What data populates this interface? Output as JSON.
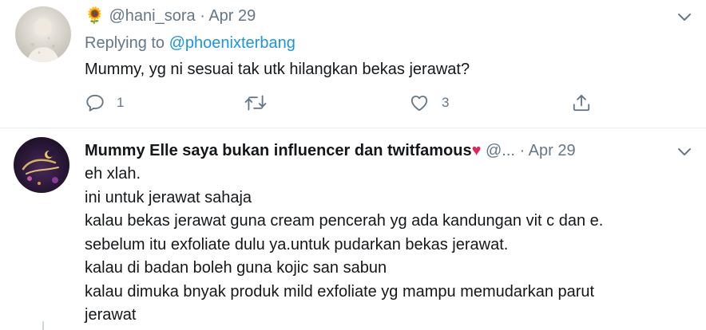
{
  "tweets": [
    {
      "emoji": "🌻",
      "handle": "@hani_sora",
      "sep": "·",
      "date": "Apr 29",
      "replying_label": "Replying to",
      "replying_to": "@phoenixterbang",
      "text": "Mummy, yg ni sesuai tak utk hilangkan bekas jerawat?",
      "reply_count": "1",
      "retweet_count": "",
      "like_count": "3"
    },
    {
      "display_name": "Mummy Elle saya bukan influencer dan twitfamous",
      "heart": "♥",
      "handle": "@...",
      "sep": "·",
      "date": "Apr 29",
      "lines": [
        "eh xlah.",
        "ini untuk jerawat sahaja",
        "kalau bekas jerawat guna cream pencerah yg ada kandungan vit c dan e.",
        "sebelum itu exfoliate dulu ya.untuk pudarkan bekas jerawat.",
        "kalau di badan boleh guna kojic san sabun",
        "kalau dimuka bnyak produk mild exfoliate yg mampu memudarkan parut",
        "jerawat"
      ]
    }
  ],
  "colors": {
    "text": "#14171a",
    "muted": "#657786",
    "link": "#1b95e0",
    "heart": "#e0245e",
    "divider": "#e6ecf0"
  },
  "icons": [
    "reply-icon",
    "retweet-icon",
    "like-icon",
    "share-icon",
    "chevron-down-icon"
  ]
}
